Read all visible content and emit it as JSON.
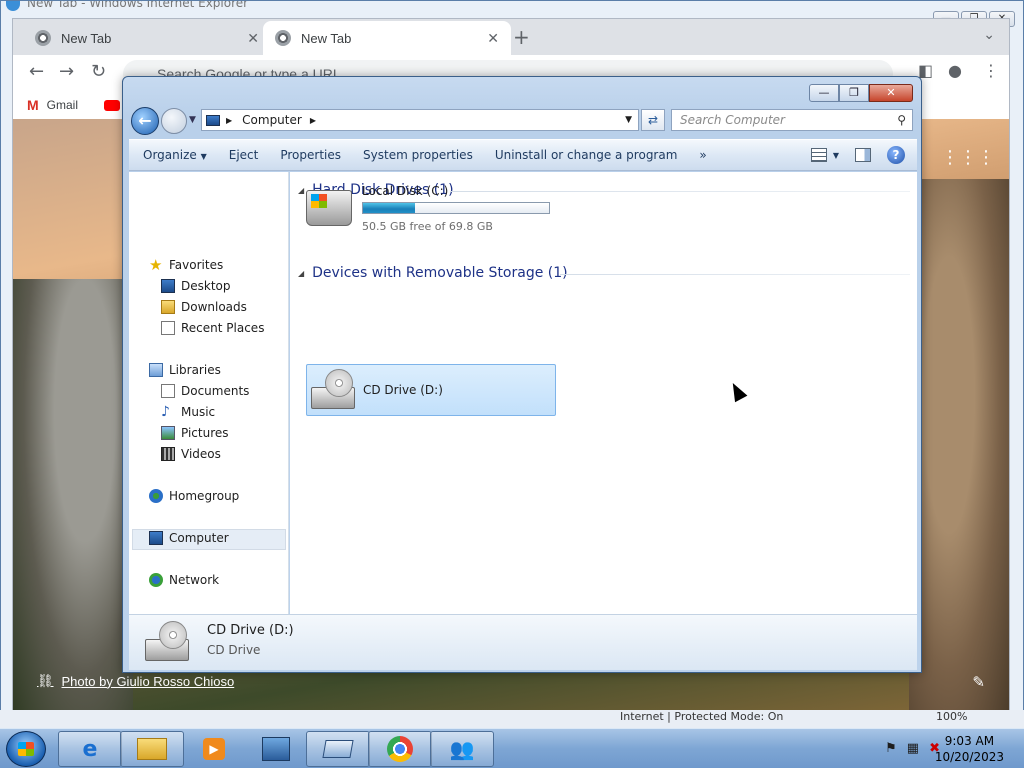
{
  "ie": {
    "title": "New Tab - Windows Internet Explorer",
    "status": "Internet | Protected Mode: On",
    "zoom": "100%"
  },
  "chrome": {
    "tabs": [
      {
        "label": "New Tab"
      },
      {
        "label": "New Tab"
      }
    ],
    "omnibox_placeholder": "Search Google or type a URL",
    "bookmarks": [
      {
        "label": "Gmail"
      }
    ],
    "photo_credit": "Photo by Giulio Rosso Chioso"
  },
  "explorer": {
    "breadcrumb": "Computer",
    "search_placeholder": "Search Computer",
    "toolbar": {
      "organize": "Organize",
      "eject": "Eject",
      "properties": "Properties",
      "system_properties": "System properties",
      "uninstall": "Uninstall or change a program",
      "more": "»"
    },
    "nav": {
      "favorites": "Favorites",
      "desktop": "Desktop",
      "downloads": "Downloads",
      "recent": "Recent Places",
      "libraries": "Libraries",
      "documents": "Documents",
      "music": "Music",
      "pictures": "Pictures",
      "videos": "Videos",
      "homegroup": "Homegroup",
      "computer": "Computer",
      "network": "Network"
    },
    "groups": {
      "hdd": "Hard Disk Drives (1)",
      "removable": "Devices with Removable Storage (1)"
    },
    "disk_c": {
      "name": "Local Disk (C:)",
      "free": "50.5 GB free of 69.8 GB",
      "used_fraction": 0.277
    },
    "cd": {
      "name": "CD Drive (D:)"
    },
    "details": {
      "name": "CD Drive (D:)",
      "type": "CD Drive"
    }
  },
  "taskbar": {
    "time": "9:03 AM",
    "date": "10/20/2023"
  }
}
